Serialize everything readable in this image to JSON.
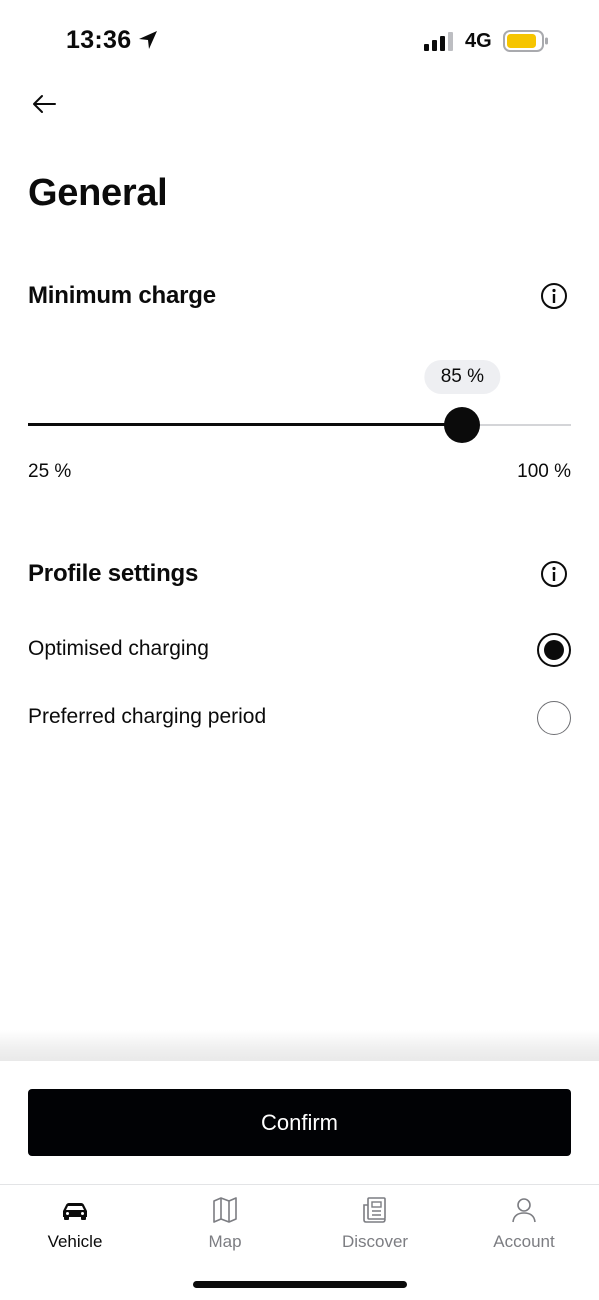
{
  "status_bar": {
    "time": "13:36",
    "network": "4G",
    "battery_color": "#f6c500"
  },
  "page": {
    "title": "General"
  },
  "minimum_charge": {
    "title": "Minimum charge",
    "value_label": "85 %",
    "value": 85,
    "min": 25,
    "max": 100,
    "min_label": "25 %",
    "max_label": "100 %"
  },
  "profile_settings": {
    "title": "Profile settings",
    "options": [
      {
        "label": "Optimised charging",
        "selected": true
      },
      {
        "label": "Preferred charging period",
        "selected": false
      }
    ]
  },
  "confirm_label": "Confirm",
  "tabs": [
    {
      "label": "Vehicle",
      "icon": "car-icon",
      "active": true
    },
    {
      "label": "Map",
      "icon": "map-icon",
      "active": false
    },
    {
      "label": "Discover",
      "icon": "news-icon",
      "active": false
    },
    {
      "label": "Account",
      "icon": "person-icon",
      "active": false
    }
  ],
  "colors": {
    "primary": "#010205",
    "muted": "#7c7d82",
    "badge_bg": "#eeeff2"
  }
}
